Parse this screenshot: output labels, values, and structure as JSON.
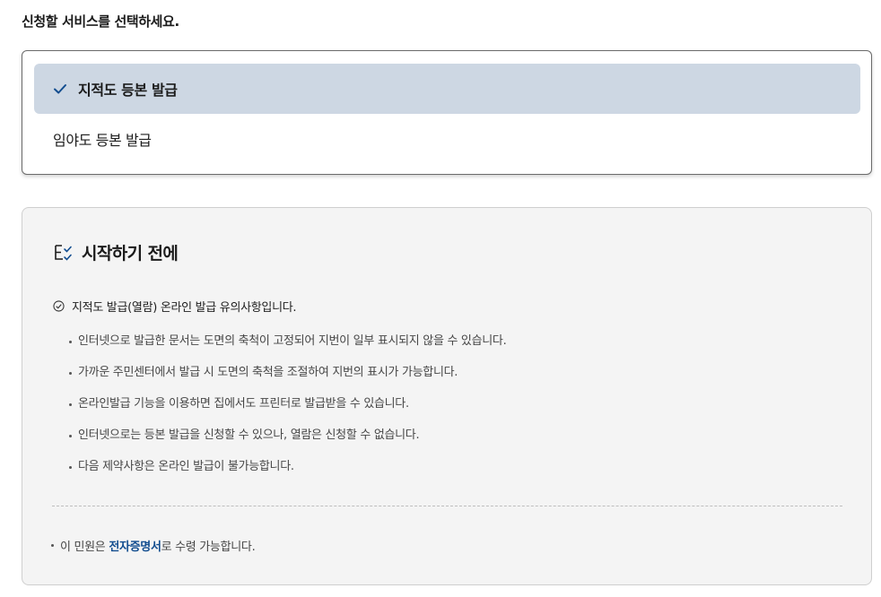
{
  "page": {
    "heading": "신청할 서비스를 선택하세요."
  },
  "service_select": {
    "options": [
      {
        "label": "지적도 등본 발급",
        "selected": true
      },
      {
        "label": "임야도 등본 발급",
        "selected": false
      }
    ]
  },
  "info": {
    "title": "시작하기 전에",
    "title_icon": "list-check-icon",
    "notice": "지적도 발급(열람) 온라인 발급 유의사항입니다.",
    "notice_icon": "circle-check-icon",
    "bullets": [
      "인터넷으로 발급한 문서는 도면의 축척이 고정되어 지번이 일부 표시되지 않을 수 있습니다.",
      "가까운 주민센터에서 발급 시 도면의 축척을 조절하여 지번의 표시가 가능합니다.",
      "온라인발급 기능을 이용하면 집에서도 프린터로 발급받을 수 있습니다.",
      "인터넷으로는 등본 발급을 신청할 수 있으나, 열람은 신청할 수 없습니다.",
      "다음 제약사항은 온라인 발급이 불가능합니다."
    ],
    "receipt": {
      "prefix": "이 민원은 ",
      "highlight": "전자증명서",
      "suffix": "로 수령 가능합니다."
    }
  },
  "colors": {
    "selected_bg": "#cdd7e3",
    "accent": "#124d8f",
    "info_bg": "#f4f4f4"
  }
}
